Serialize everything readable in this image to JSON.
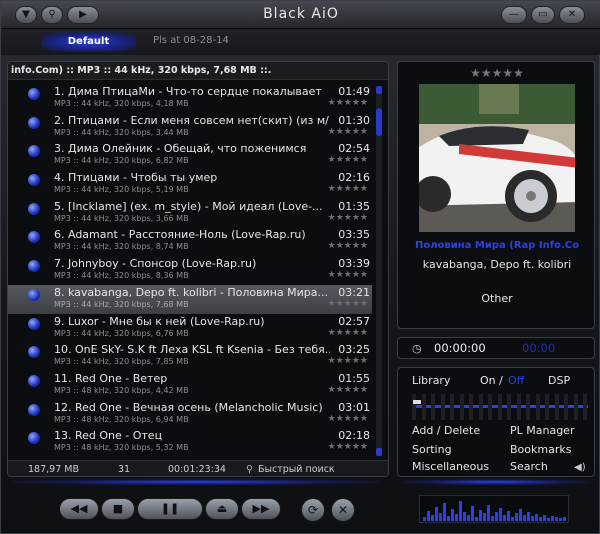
{
  "window": {
    "title": "Black AiO",
    "left_buttons": [
      "▼",
      "⚲",
      "▶"
    ],
    "right_buttons": [
      "—",
      "▭",
      "✕"
    ]
  },
  "tabs": [
    {
      "label": "Default",
      "active": true
    },
    {
      "label": "Pls at 08-28-14",
      "active": false
    }
  ],
  "playlist": {
    "info_bar": "info.Com) :: MP3 :: 44 kHz, 320 kbps, 7,68 MB ::.",
    "rating_stars": "★★★★★",
    "tracks": [
      {
        "title": "1. Дима ПтицаМи - Что-то сердце покалывает",
        "duration": "01:49",
        "details": "MP3 :: 44 kHz, 320 kbps, 4,18 MB",
        "selected": false
      },
      {
        "title": "2. Птицами - Если меня совсем нет(скит) (из м/...",
        "duration": "01:30",
        "details": "MP3 :: 44 kHz, 320 kbps, 3,44 MB",
        "selected": false
      },
      {
        "title": "3. Дима Олейник - Обещай, что поженимся",
        "duration": "02:54",
        "details": "MP3 :: 44 kHz, 320 kbps, 6,82 MB",
        "selected": false
      },
      {
        "title": "4. Птицами - Чтобы ты умер",
        "duration": "02:16",
        "details": "MP3 :: 44 kHz, 320 kbps, 5,19 MB",
        "selected": false
      },
      {
        "title": "5. [Incklame] (ex. m_style) - Мой идеал (Love-...",
        "duration": "01:35",
        "details": "MP3 :: 44 kHz, 320 kbps, 3,66 MB",
        "selected": false
      },
      {
        "title": "6. Adamant - Расстояние-Ноль  (Love-Rap.ru)",
        "duration": "03:35",
        "details": "MP3 :: 44 kHz, 320 kbps, 8,74 MB",
        "selected": false
      },
      {
        "title": "7. Johnyboy - Спонсор (Love-Rap.ru)",
        "duration": "03:39",
        "details": "MP3 :: 44 kHz, 320 kbps, 8,36 MB",
        "selected": false
      },
      {
        "title": "8. kavabanga,  Depo ft. kolibri - Половина Мира...",
        "duration": "03:21",
        "details": "MP3 :: 44 kHz, 320 kbps, 7,68 MB",
        "selected": true
      },
      {
        "title": "9. Luxor - Мне бы к ней  (Love-Rap.ru)",
        "duration": "02:57",
        "details": "MP3 :: 44 kHz, 320 kbps, 6,76 MB",
        "selected": false
      },
      {
        "title": "10. OnE SkY- S.K ft Леха KSL ft Ksenia - Без тебя...",
        "duration": "03:25",
        "details": "MP3 :: 44 kHz, 320 kbps, 7,85 MB",
        "selected": false
      },
      {
        "title": "11. Red One - Ветер",
        "duration": "01:55",
        "details": "MP3 :: 48 kHz, 320 kbps, 4,42 MB",
        "selected": false
      },
      {
        "title": "12. Red One - Вечная осень (Melancholic Music)",
        "duration": "03:01",
        "details": "MP3 :: 48 kHz, 320 kbps, 6,94 MB",
        "selected": false
      },
      {
        "title": "13. Red One - Отец",
        "duration": "02:18",
        "details": "MP3 :: 48 kHz, 320 kbps, 5,32 MB",
        "selected": false
      }
    ],
    "status": {
      "total_size": "187,97 MB",
      "count": "31",
      "total_time": "00:01:23:34",
      "search_placeholder": "Быстрый поиск"
    }
  },
  "now_playing": {
    "rating_stars": "★★★★★",
    "title": "Половина Мира (Rap Info.Co",
    "artist": "kavabanga,  Depo ft. kolibri",
    "genre": "Other"
  },
  "timer": {
    "clock_icon": "clock-icon",
    "elapsed": "00:00:00",
    "remaining": "00:00"
  },
  "controls": {
    "library": "Library",
    "on": "On /",
    "off": "Off",
    "dsp": "DSP",
    "add_delete": "Add / Delete",
    "pl_manager": "PL Manager",
    "sorting": "Sorting",
    "bookmarks": "Bookmarks",
    "misc": "Miscellaneous",
    "search": "Search"
  },
  "transport": {
    "prev": "◀◀",
    "stop": "■",
    "pause": "❚❚",
    "eject": "⏏",
    "next": "▶▶",
    "repeat": "⟳",
    "shuffle": "✕"
  },
  "colors": {
    "accent": "#2b41e8",
    "background": "#0c0d10"
  }
}
